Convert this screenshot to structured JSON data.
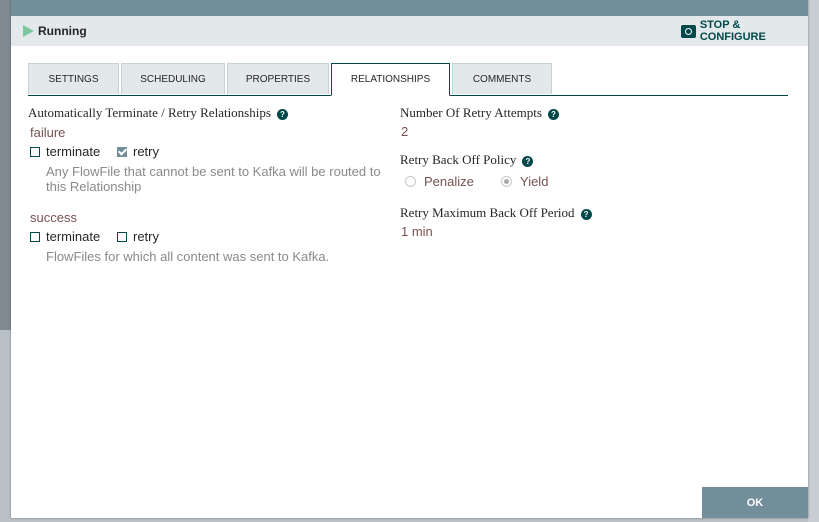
{
  "status": {
    "label": "Running",
    "stop_label": "STOP & CONFIGURE"
  },
  "tabs": [
    {
      "label": "SETTINGS"
    },
    {
      "label": "SCHEDULING"
    },
    {
      "label": "PROPERTIES"
    },
    {
      "label": "RELATIONSHIPS"
    },
    {
      "label": "COMMENTS"
    }
  ],
  "active_tab": "RELATIONSHIPS",
  "relationships": {
    "heading": "Automatically Terminate / Retry Relationships",
    "help_glyph": "?",
    "items": [
      {
        "name": "failure",
        "terminate_label": "terminate",
        "terminate_checked": false,
        "retry_label": "retry",
        "retry_checked": true,
        "description": "Any FlowFile that cannot be sent to Kafka will be routed to this Relationship"
      },
      {
        "name": "success",
        "terminate_label": "terminate",
        "terminate_checked": false,
        "retry_label": "retry",
        "retry_checked": false,
        "description": "FlowFiles for which all content was sent to Kafka."
      }
    ]
  },
  "retry": {
    "attempts_label": "Number Of Retry Attempts",
    "attempts_value": "2",
    "policy_label": "Retry Back Off Policy",
    "policy_options": [
      "Penalize",
      "Yield"
    ],
    "policy_selected": "Yield",
    "max_period_label": "Retry Maximum Back Off Period",
    "max_period_value": "1 min"
  },
  "footer": {
    "ok_label": "OK"
  },
  "colors": {
    "accent": "#004849",
    "header": "#728e9b",
    "value": "#775351"
  }
}
